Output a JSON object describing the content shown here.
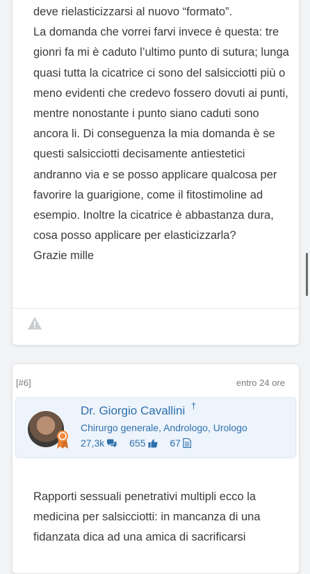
{
  "post1": {
    "lines": [
      "deve rielasticizzarsi al nuovo “formato”.",
      "La domanda che vorrei farvi invece è questa: tre gionri fa mi è caduto l’ultimo punto di sutura; lunga quasi tutta la cicatrice ci sono del salsicciotti più o meno evidenti che credevo fossero dovuti ai punti, mentre nonostante i punto siano caduti sono ancora li. Di conseguenza la mia domanda è se questi salsicciotti decisamente antiestetici andranno via e se posso applicare qualcosa per favorire la guarigione, come il fitostimoline ad esempio. Inoltre la cicatrice è abbastanza dura, cosa posso applicare per elasticizzarla?",
      "Grazie mille"
    ],
    "report_icon": "warning-triangle-icon"
  },
  "post2": {
    "number": "[#6]",
    "time": "entro 24 ore",
    "doctor_name": "Dr. Giorgio Cavallini",
    "doctor_mark": "†",
    "specialties": [
      "Chirurgo generale",
      "Andrologo",
      "Urologo"
    ],
    "stats": [
      {
        "value": "27,3k",
        "icon": "chat-bubbles-icon"
      },
      {
        "value": "655",
        "icon": "thumbs-up-icon"
      },
      {
        "value": "67",
        "icon": "document-icon"
      }
    ],
    "text": "Rapporti sessuali penetrativi multipli ecco la medicina per salsicciotti: in mancanza di una fidanzata dica ad una amica di sacrificarsi"
  },
  "colors": {
    "link": "#2d6fad",
    "text": "#3a3a3a",
    "badge": "#e8833a"
  }
}
